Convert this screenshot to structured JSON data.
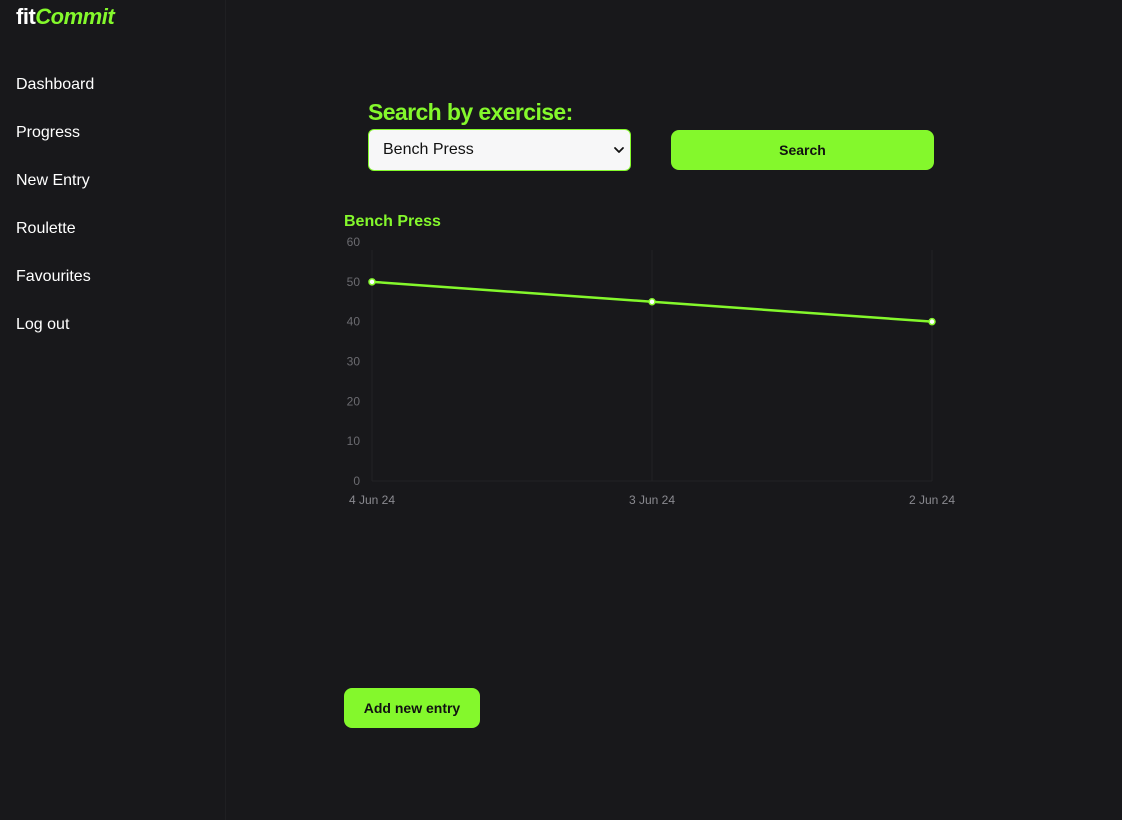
{
  "app": {
    "logo_part1": "fit",
    "logo_part2": "Commit"
  },
  "sidebar": {
    "items": [
      {
        "label": "Dashboard"
      },
      {
        "label": "Progress"
      },
      {
        "label": "New Entry"
      },
      {
        "label": "Roulette"
      },
      {
        "label": "Favourites"
      },
      {
        "label": "Log out"
      }
    ]
  },
  "search": {
    "title": "Search by exercise:",
    "selected_exercise": "Bench Press",
    "button_label": "Search"
  },
  "actions": {
    "add_entry_label": "Add new entry"
  },
  "colors": {
    "accent": "#84f82c",
    "background": "#18181b"
  },
  "chart_data": {
    "type": "line",
    "title": "Bench Press",
    "categories": [
      "4 Jun 24",
      "3 Jun 24",
      "2 Jun 24"
    ],
    "series": [
      {
        "values": [
          50,
          45,
          40
        ]
      }
    ],
    "ylim": [
      0,
      60
    ],
    "yticks": [
      0,
      10,
      20,
      30,
      40,
      50,
      60
    ],
    "xlabel": "",
    "ylabel": "",
    "grid": true
  }
}
